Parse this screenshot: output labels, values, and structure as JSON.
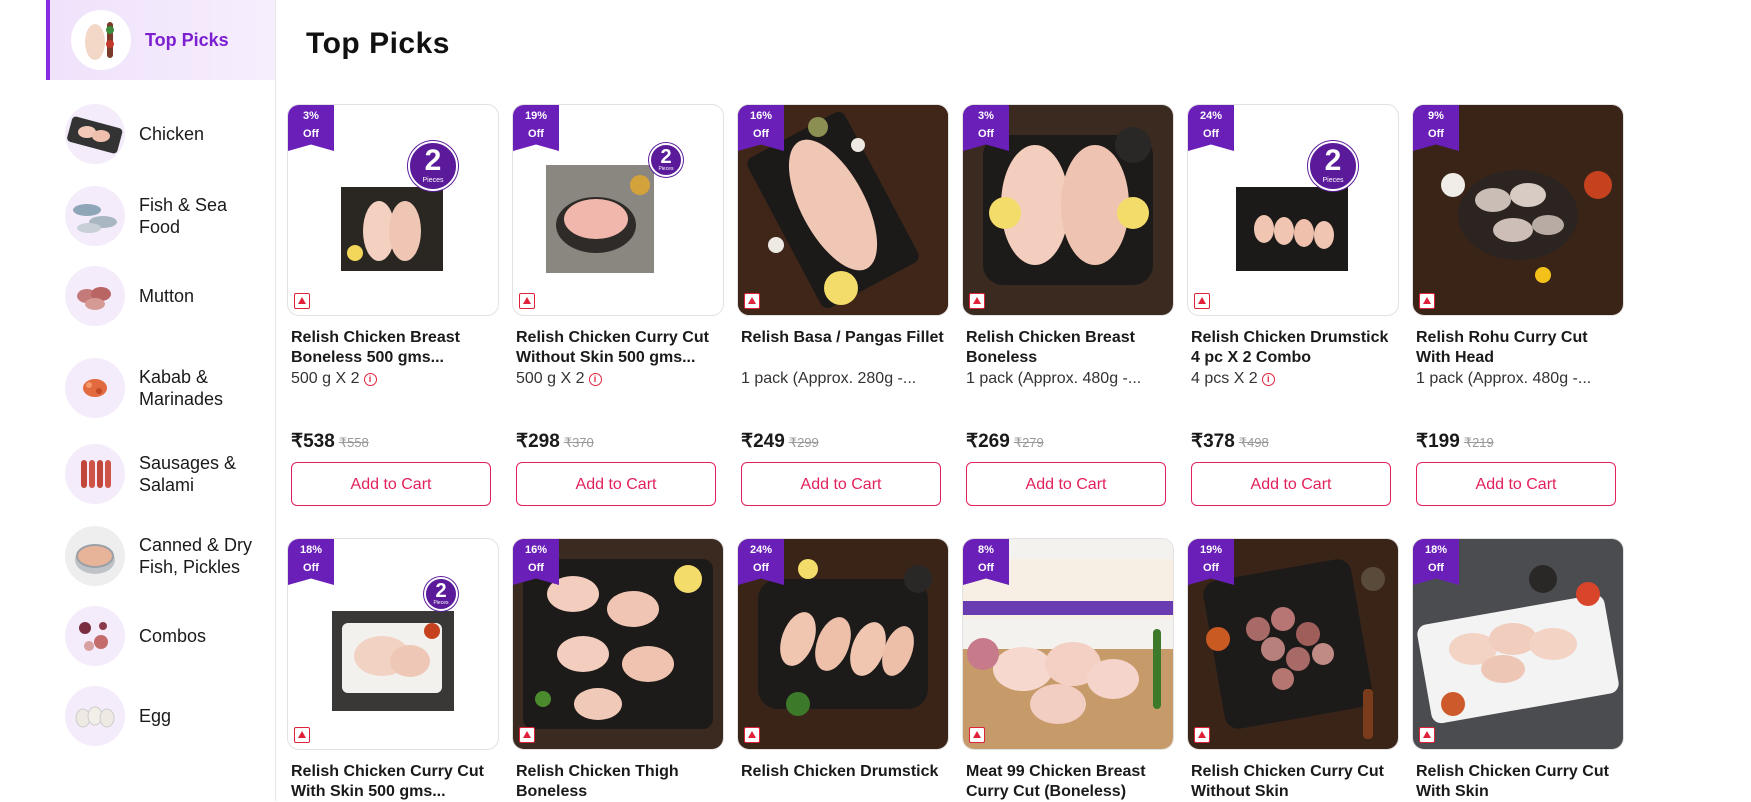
{
  "sidebar": {
    "items": [
      {
        "label": "Top Picks",
        "icon": "top-picks-thumb"
      },
      {
        "label": "Chicken",
        "icon": "chicken-thumb"
      },
      {
        "label": "Fish & Sea Food",
        "icon": "fish-thumb"
      },
      {
        "label": "Mutton",
        "icon": "mutton-thumb"
      },
      {
        "label": "Kabab & Marinades",
        "icon": "kabab-thumb"
      },
      {
        "label": "Sausages & Salami",
        "icon": "sausage-thumb"
      },
      {
        "label": "Canned & Dry Fish, Pickles",
        "icon": "canned-thumb"
      },
      {
        "label": "Combos",
        "icon": "combos-thumb"
      },
      {
        "label": "Egg",
        "icon": "egg-thumb"
      }
    ]
  },
  "main": {
    "title": "Top Picks",
    "badge_off": "Off",
    "pieces_label": "Pieces",
    "add_to_cart": "Add to Cart",
    "products": [
      {
        "discount": "3%",
        "name": "Relish Chicken Breast Boneless 500 gms...",
        "qty": "500 g X 2",
        "info": true,
        "price": "₹538",
        "mrp": "₹558",
        "pieces": "2"
      },
      {
        "discount": "19%",
        "name": "Relish Chicken Curry Cut Without Skin 500 gms...",
        "qty": "500 g X 2",
        "info": true,
        "price": "₹298",
        "mrp": "₹370",
        "pieces": "2"
      },
      {
        "discount": "16%",
        "name": "Relish Basa / Pangas Fillet",
        "qty": "1 pack (Approx. 280g -...",
        "info": false,
        "price": "₹249",
        "mrp": "₹299"
      },
      {
        "discount": "3%",
        "name": "Relish Chicken Breast Boneless",
        "qty": "1 pack (Approx. 480g -...",
        "info": false,
        "price": "₹269",
        "mrp": "₹279"
      },
      {
        "discount": "24%",
        "name": "Relish Chicken Drumstick 4 pc X 2 Combo",
        "qty": "4 pcs X 2",
        "info": true,
        "price": "₹378",
        "mrp": "₹498",
        "pieces": "2"
      },
      {
        "discount": "9%",
        "name": "Relish Rohu Curry Cut With Head",
        "qty": "1 pack (Approx. 480g -...",
        "info": false,
        "price": "₹199",
        "mrp": "₹219"
      },
      {
        "discount": "18%",
        "name": "Relish Chicken Curry Cut With Skin 500 gms...",
        "pieces": "2"
      },
      {
        "discount": "16%",
        "name": "Relish Chicken Thigh Boneless"
      },
      {
        "discount": "24%",
        "name": "Relish Chicken Drumstick"
      },
      {
        "discount": "8%",
        "name": "Meat 99 Chicken Breast Curry Cut (Boneless)"
      },
      {
        "discount": "19%",
        "name": "Relish Chicken Curry Cut Without Skin"
      },
      {
        "discount": "18%",
        "name": "Relish Chicken Curry Cut With Skin"
      }
    ]
  }
}
